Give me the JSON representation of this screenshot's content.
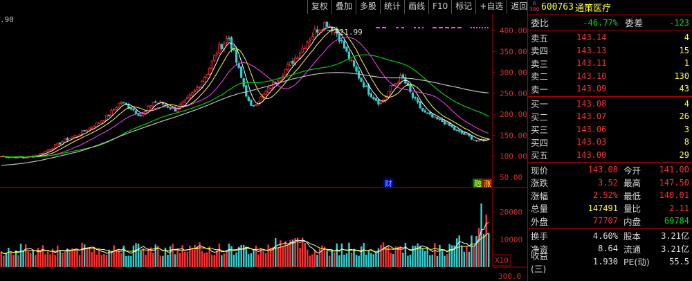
{
  "toolbar": {
    "buttons": [
      "复权",
      "叠加",
      "多股",
      "统计",
      "画线",
      "F10",
      "标记",
      "+自选",
      "返回"
    ]
  },
  "left_edge_label": ".90",
  "price_chart": {
    "high_marker": "421.99",
    "y_ticks": [
      "400.00",
      "350.00",
      "300.00",
      "250.00",
      "200.00",
      "150.00",
      "100.00",
      "50.00"
    ],
    "fin_marker": "财",
    "events_marker_a": "融",
    "events_marker_b": "涨"
  },
  "volume_chart": {
    "y_ticks": [
      "20000",
      "10000"
    ],
    "unit_label": "X10",
    "next_tick": "300.0"
  },
  "chart_data": {
    "type": "line",
    "title": "",
    "series": [
      {
        "name": "",
        "role": "price",
        "values": [
          100,
          98,
          97,
          100,
          110,
          125,
          140,
          150,
          165,
          180,
          200,
          230,
          215,
          195,
          230,
          225,
          210,
          230,
          260,
          300,
          355,
          385,
          300,
          215,
          240,
          270,
          300,
          330,
          365,
          400,
          420,
          395,
          340,
          290,
          250,
          225,
          265,
          290,
          240,
          205,
          190,
          180,
          160,
          150,
          135,
          143
        ]
      },
      {
        "name": "",
        "role": "ma_slow",
        "values": [
          78,
          80,
          83,
          87,
          92,
          98,
          104,
          110,
          118,
          127,
          137,
          148,
          158,
          167,
          176,
          185,
          193,
          202,
          211,
          221,
          232,
          242,
          250,
          256,
          263,
          270,
          278,
          285,
          291,
          296,
          299,
          300,
          299,
          296,
          292,
          288,
          287,
          287,
          285,
          281,
          276,
          270,
          265,
          259,
          254,
          251
        ]
      }
    ],
    "ylim": [
      30,
      440
    ],
    "grid": false,
    "volume_ylim": [
      0,
      26000
    ]
  },
  "panel": {
    "rank_badge_top": "R",
    "rank_badge_bottom": "300",
    "code": "600763",
    "name": "通策医疗",
    "weibi_label": "委比",
    "weibi_value": "-46.77%",
    "weicha_label": "委差",
    "weicha_value": "-123",
    "sell": [
      {
        "label": "卖五",
        "price": "143.14",
        "vol": "4"
      },
      {
        "label": "卖四",
        "price": "143.13",
        "vol": "15"
      },
      {
        "label": "卖三",
        "price": "143.11",
        "vol": "1"
      },
      {
        "label": "卖二",
        "price": "143.10",
        "vol": "130"
      },
      {
        "label": "卖一",
        "price": "143.09",
        "vol": "43"
      }
    ],
    "buy": [
      {
        "label": "买一",
        "price": "143.08",
        "vol": "4"
      },
      {
        "label": "买二",
        "price": "143.07",
        "vol": "26"
      },
      {
        "label": "买三",
        "price": "143.06",
        "vol": "3"
      },
      {
        "label": "买四",
        "price": "143.03",
        "vol": "8"
      },
      {
        "label": "买五",
        "price": "143.00",
        "vol": "29"
      }
    ],
    "quote1": [
      {
        "l1": "现价",
        "v1": "143.08",
        "c1": "red",
        "l2": "今开",
        "v2": "141.00",
        "c2": "red"
      },
      {
        "l1": "涨跌",
        "v1": "3.52",
        "c1": "red",
        "l2": "最高",
        "v2": "147.50",
        "c2": "red"
      },
      {
        "l1": "涨幅",
        "v1": "2.52%",
        "c1": "red",
        "l2": "最低",
        "v2": "140.01",
        "c2": "red"
      },
      {
        "l1": "总量",
        "v1": "147491",
        "c1": "yellow",
        "l2": "量比",
        "v2": "2.11",
        "c2": "red"
      },
      {
        "l1": "外盘",
        "v1": "77707",
        "c1": "red",
        "l2": "内盘",
        "v2": "69784",
        "c2": "green"
      }
    ],
    "quote2": [
      {
        "l1": "换手",
        "v1": "4.60%",
        "c1": "white",
        "l2": "股本",
        "v2": "3.21亿",
        "c2": "white"
      },
      {
        "l1": "净资",
        "v1": "8.64",
        "c1": "white",
        "l2": "流通",
        "v2": "3.21亿",
        "c2": "white"
      },
      {
        "l1": "收益(三)",
        "v1": "1.930",
        "c1": "white",
        "l2": "PE(动)",
        "v2": "55.5",
        "c2": "white"
      }
    ]
  }
}
